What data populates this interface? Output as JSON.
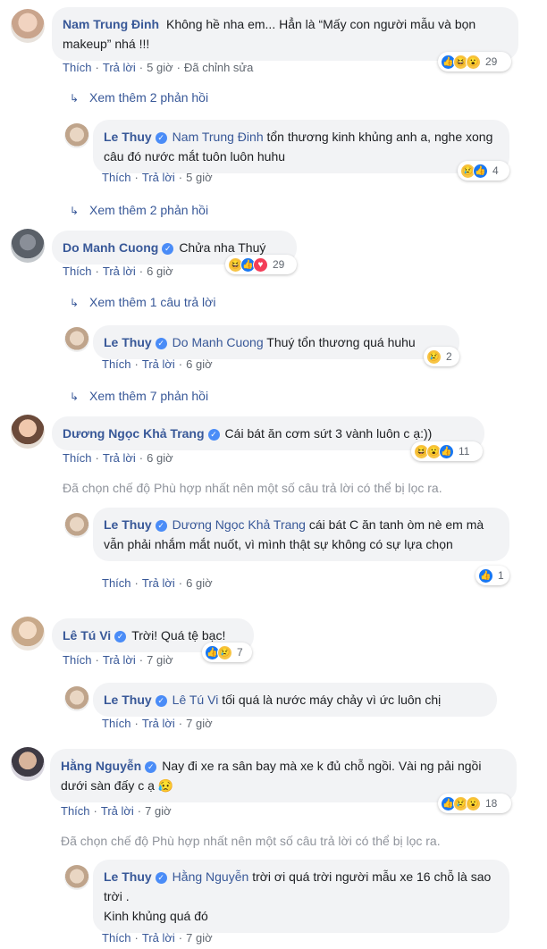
{
  "comments": [
    {
      "author": "Nam Trung Đinh",
      "text": "Không hề nha em... Hẳn là “Mấy con người mẫu và bọn makeup” nhá !!!",
      "actions": {
        "like": "Thích",
        "reply": "Trả lời",
        "time": "5 giờ",
        "edited": "Đã chỉnh sửa"
      },
      "reaction_count": "29",
      "reactions": [
        "like-icon",
        "haha-icon",
        "wow-icon"
      ],
      "view_more": "Xem thêm 2 phản hồi",
      "reply": {
        "author": "Le Thuy",
        "mention": "Nam Trung Đinh",
        "text": "tổn thương kinh khủng anh a, nghe xong câu đó nước mắt tuôn luôn huhu",
        "actions": {
          "like": "Thích",
          "reply": "Trả lời",
          "time": "5 giờ"
        },
        "reaction_count": "4",
        "reactions": [
          "sad-icon",
          "like-icon"
        ]
      },
      "view_more_after": "Xem thêm 2 phản hồi"
    },
    {
      "author": "Do Manh Cuong",
      "text": "Chửa nha Thuý",
      "actions": {
        "like": "Thích",
        "reply": "Trả lời",
        "time": "6 giờ"
      },
      "reaction_count": "29",
      "reactions": [
        "haha-icon",
        "like-icon",
        "love-icon"
      ],
      "view_more": "Xem thêm 1 câu trả lời",
      "reply": {
        "author": "Le Thuy",
        "mention": "Do Manh Cuong",
        "text": "Thuý tổn thương quá huhu",
        "actions": {
          "like": "Thích",
          "reply": "Trả lời",
          "time": "6 giờ"
        },
        "reaction_count": "2",
        "reactions": [
          "sad-icon"
        ]
      },
      "view_more_after": "Xem thêm 7 phản hồi"
    },
    {
      "author": "Dương Ngọc Khả Trang",
      "text": "Cái bát ăn cơm sứt 3 vành luôn c ạ:))",
      "actions": {
        "like": "Thích",
        "reply": "Trả lời",
        "time": "6 giờ"
      },
      "reaction_count": "11",
      "reactions": [
        "haha-icon",
        "wow-icon",
        "like-icon"
      ],
      "notice": "Đã chọn chế độ Phù hợp nhất nên một số câu trả lời có thể bị lọc ra.",
      "reply": {
        "author": "Le Thuy",
        "mention": "Dương Ngọc Khả Trang",
        "text": "cái bát C ăn tanh òm nè em mà vẫn phải nhắm mắt nuốt, vì mình thật sự không có sự lựa chọn",
        "actions": {
          "like": "Thích",
          "reply": "Trả lời",
          "time": "6 giờ"
        },
        "reaction_count": "1",
        "reactions": [
          "like-icon"
        ]
      }
    },
    {
      "author": "Lê Tú Vi",
      "text": "Trời! Quá tệ bạc!",
      "actions": {
        "like": "Thích",
        "reply": "Trả lời",
        "time": "7 giờ"
      },
      "reaction_count": "7",
      "reactions": [
        "like-icon",
        "sad-icon"
      ],
      "reply": {
        "author": "Le Thuy",
        "mention": "Lê Tú Vi",
        "text": "tối quá là nước máy chảy vì ức luôn chị",
        "actions": {
          "like": "Thích",
          "reply": "Trả lời",
          "time": "7 giờ"
        }
      }
    },
    {
      "author": "Hằng Nguyễn",
      "text": "Nay đi xe ra sân bay mà xe k đủ chỗ ngồi. Vài ng pải ngồi dưới sàn đấy c ạ 😥",
      "actions": {
        "like": "Thích",
        "reply": "Trả lời",
        "time": "7 giờ"
      },
      "reaction_count": "18",
      "reactions": [
        "like-icon",
        "sad-icon",
        "wow-icon"
      ],
      "notice": "Đã chọn chế độ Phù hợp nhất nên một số câu trả lời có thể bị lọc ra.",
      "reply": {
        "author": "Le Thuy",
        "mention": "Hằng Nguyễn",
        "text_line1": "trời ơi quá trời người mẫu xe 16 chỗ là sao trời .",
        "text_line2": "Kinh khủng quá đó",
        "actions": {
          "like": "Thích",
          "reply": "Trả lời",
          "time": "7 giờ"
        }
      }
    }
  ]
}
